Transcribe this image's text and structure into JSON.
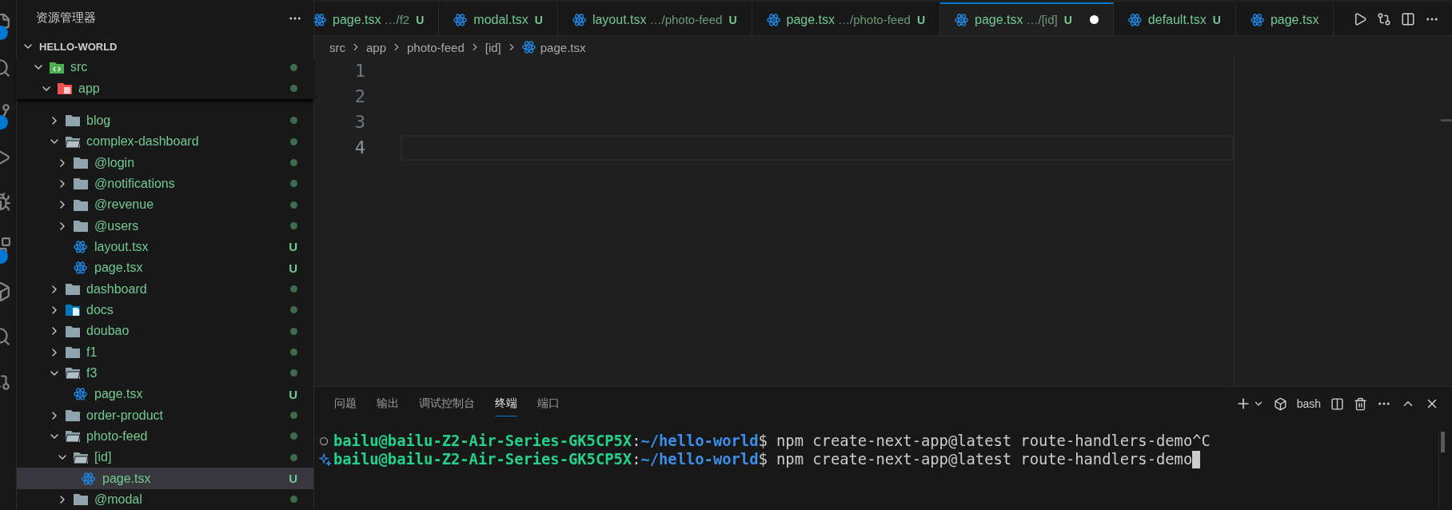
{
  "explorer": {
    "title": "资源管理器",
    "root": {
      "label": "HELLO-WORLD",
      "expanded": true
    }
  },
  "tree": [
    {
      "label": "src",
      "kind": "src",
      "expanded": true,
      "has_changes": true,
      "selected": false,
      "children": [
        {
          "label": "app",
          "kind": "app",
          "expanded": true,
          "has_changes": true,
          "selected": false,
          "children": [
            {
              "label": "blog",
              "kind": "folder",
              "expanded": false,
              "has_changes": true,
              "selected": false
            },
            {
              "label": "complex-dashboard",
              "kind": "folder",
              "expanded": true,
              "has_changes": true,
              "selected": false,
              "children": [
                {
                  "label": "@login",
                  "kind": "folder",
                  "expanded": false,
                  "has_changes": true,
                  "selected": false
                },
                {
                  "label": "@notifications",
                  "kind": "folder",
                  "expanded": false,
                  "has_changes": true,
                  "selected": false
                },
                {
                  "label": "@revenue",
                  "kind": "folder",
                  "expanded": false,
                  "has_changes": true,
                  "selected": false
                },
                {
                  "label": "@users",
                  "kind": "folder",
                  "expanded": false,
                  "has_changes": true,
                  "selected": false
                },
                {
                  "label": "layout.tsx",
                  "kind": "react",
                  "status": "U",
                  "selected": false
                },
                {
                  "label": "page.tsx",
                  "kind": "react",
                  "status": "U",
                  "selected": false
                }
              ]
            },
            {
              "label": "dashboard",
              "kind": "folder",
              "expanded": false,
              "has_changes": true,
              "selected": false
            },
            {
              "label": "docs",
              "kind": "docs",
              "expanded": false,
              "has_changes": true,
              "selected": false
            },
            {
              "label": "doubao",
              "kind": "folder",
              "expanded": false,
              "has_changes": true,
              "selected": false
            },
            {
              "label": "f1",
              "kind": "folder",
              "expanded": false,
              "has_changes": true,
              "selected": false
            },
            {
              "label": "f3",
              "kind": "folder",
              "expanded": true,
              "has_changes": true,
              "selected": false,
              "children": [
                {
                  "label": "page.tsx",
                  "kind": "react",
                  "status": "U",
                  "selected": false
                }
              ]
            },
            {
              "label": "order-product",
              "kind": "folder",
              "expanded": false,
              "has_changes": true,
              "selected": false
            },
            {
              "label": "photo-feed",
              "kind": "folder",
              "expanded": true,
              "has_changes": true,
              "selected": false,
              "children": [
                {
                  "label": "[id]",
                  "kind": "folder",
                  "expanded": true,
                  "has_changes": true,
                  "selected": false,
                  "children": [
                    {
                      "label": "page.tsx",
                      "kind": "react",
                      "status": "U",
                      "selected": true
                    }
                  ]
                },
                {
                  "label": "@modal",
                  "kind": "folder",
                  "expanded": false,
                  "has_changes": true,
                  "selected": false
                }
              ]
            }
          ]
        }
      ]
    }
  ],
  "tabs": [
    {
      "label": "page.tsx",
      "description": "…/f2",
      "status": "U",
      "selected": false,
      "dirty": false
    },
    {
      "label": "modal.tsx",
      "status": "U",
      "selected": false,
      "dirty": false
    },
    {
      "label": "layout.tsx",
      "description": "…/photo-feed",
      "status": "U",
      "selected": false,
      "dirty": false
    },
    {
      "label": "page.tsx",
      "description": "…/photo-feed",
      "status": "U",
      "selected": false,
      "dirty": false
    },
    {
      "label": "page.tsx",
      "description": "…/[id]",
      "status": "U",
      "selected": true,
      "dirty": true
    },
    {
      "label": "default.tsx",
      "status": "U",
      "selected": false,
      "dirty": false
    },
    {
      "label": "page.tsx",
      "selected": false,
      "dirty": false
    }
  ],
  "breadcrumb": [
    "src",
    "app",
    "photo-feed",
    "[id]",
    "page.tsx"
  ],
  "editor": {
    "lines": [
      {
        "number": "1",
        "current": false
      },
      {
        "number": "2",
        "current": false
      },
      {
        "number": "3",
        "current": false
      },
      {
        "number": "4",
        "current": true
      }
    ]
  },
  "panel": {
    "tabs": [
      {
        "label": "问题",
        "selected": false
      },
      {
        "label": "输出",
        "selected": false
      },
      {
        "label": "调试控制台",
        "selected": false
      },
      {
        "label": "终端",
        "selected": true
      },
      {
        "label": "端口",
        "selected": false
      }
    ],
    "shell": "bash"
  },
  "terminal": [
    {
      "kind": "circle",
      "user": "bailu@bailu-Z2-Air-Series-GK5CP5X",
      "separator": ":",
      "path": "~/hello-world",
      "command": "$ npm create-next-app@latest route-handlers-demo^C",
      "cursor": false
    },
    {
      "kind": "sparkle",
      "user": "bailu@bailu-Z2-Air-Series-GK5CP5X",
      "separator": ":",
      "path": "~/hello-world",
      "command": "$ npm create-next-app@latest route-handlers-demo",
      "cursor": true
    }
  ]
}
